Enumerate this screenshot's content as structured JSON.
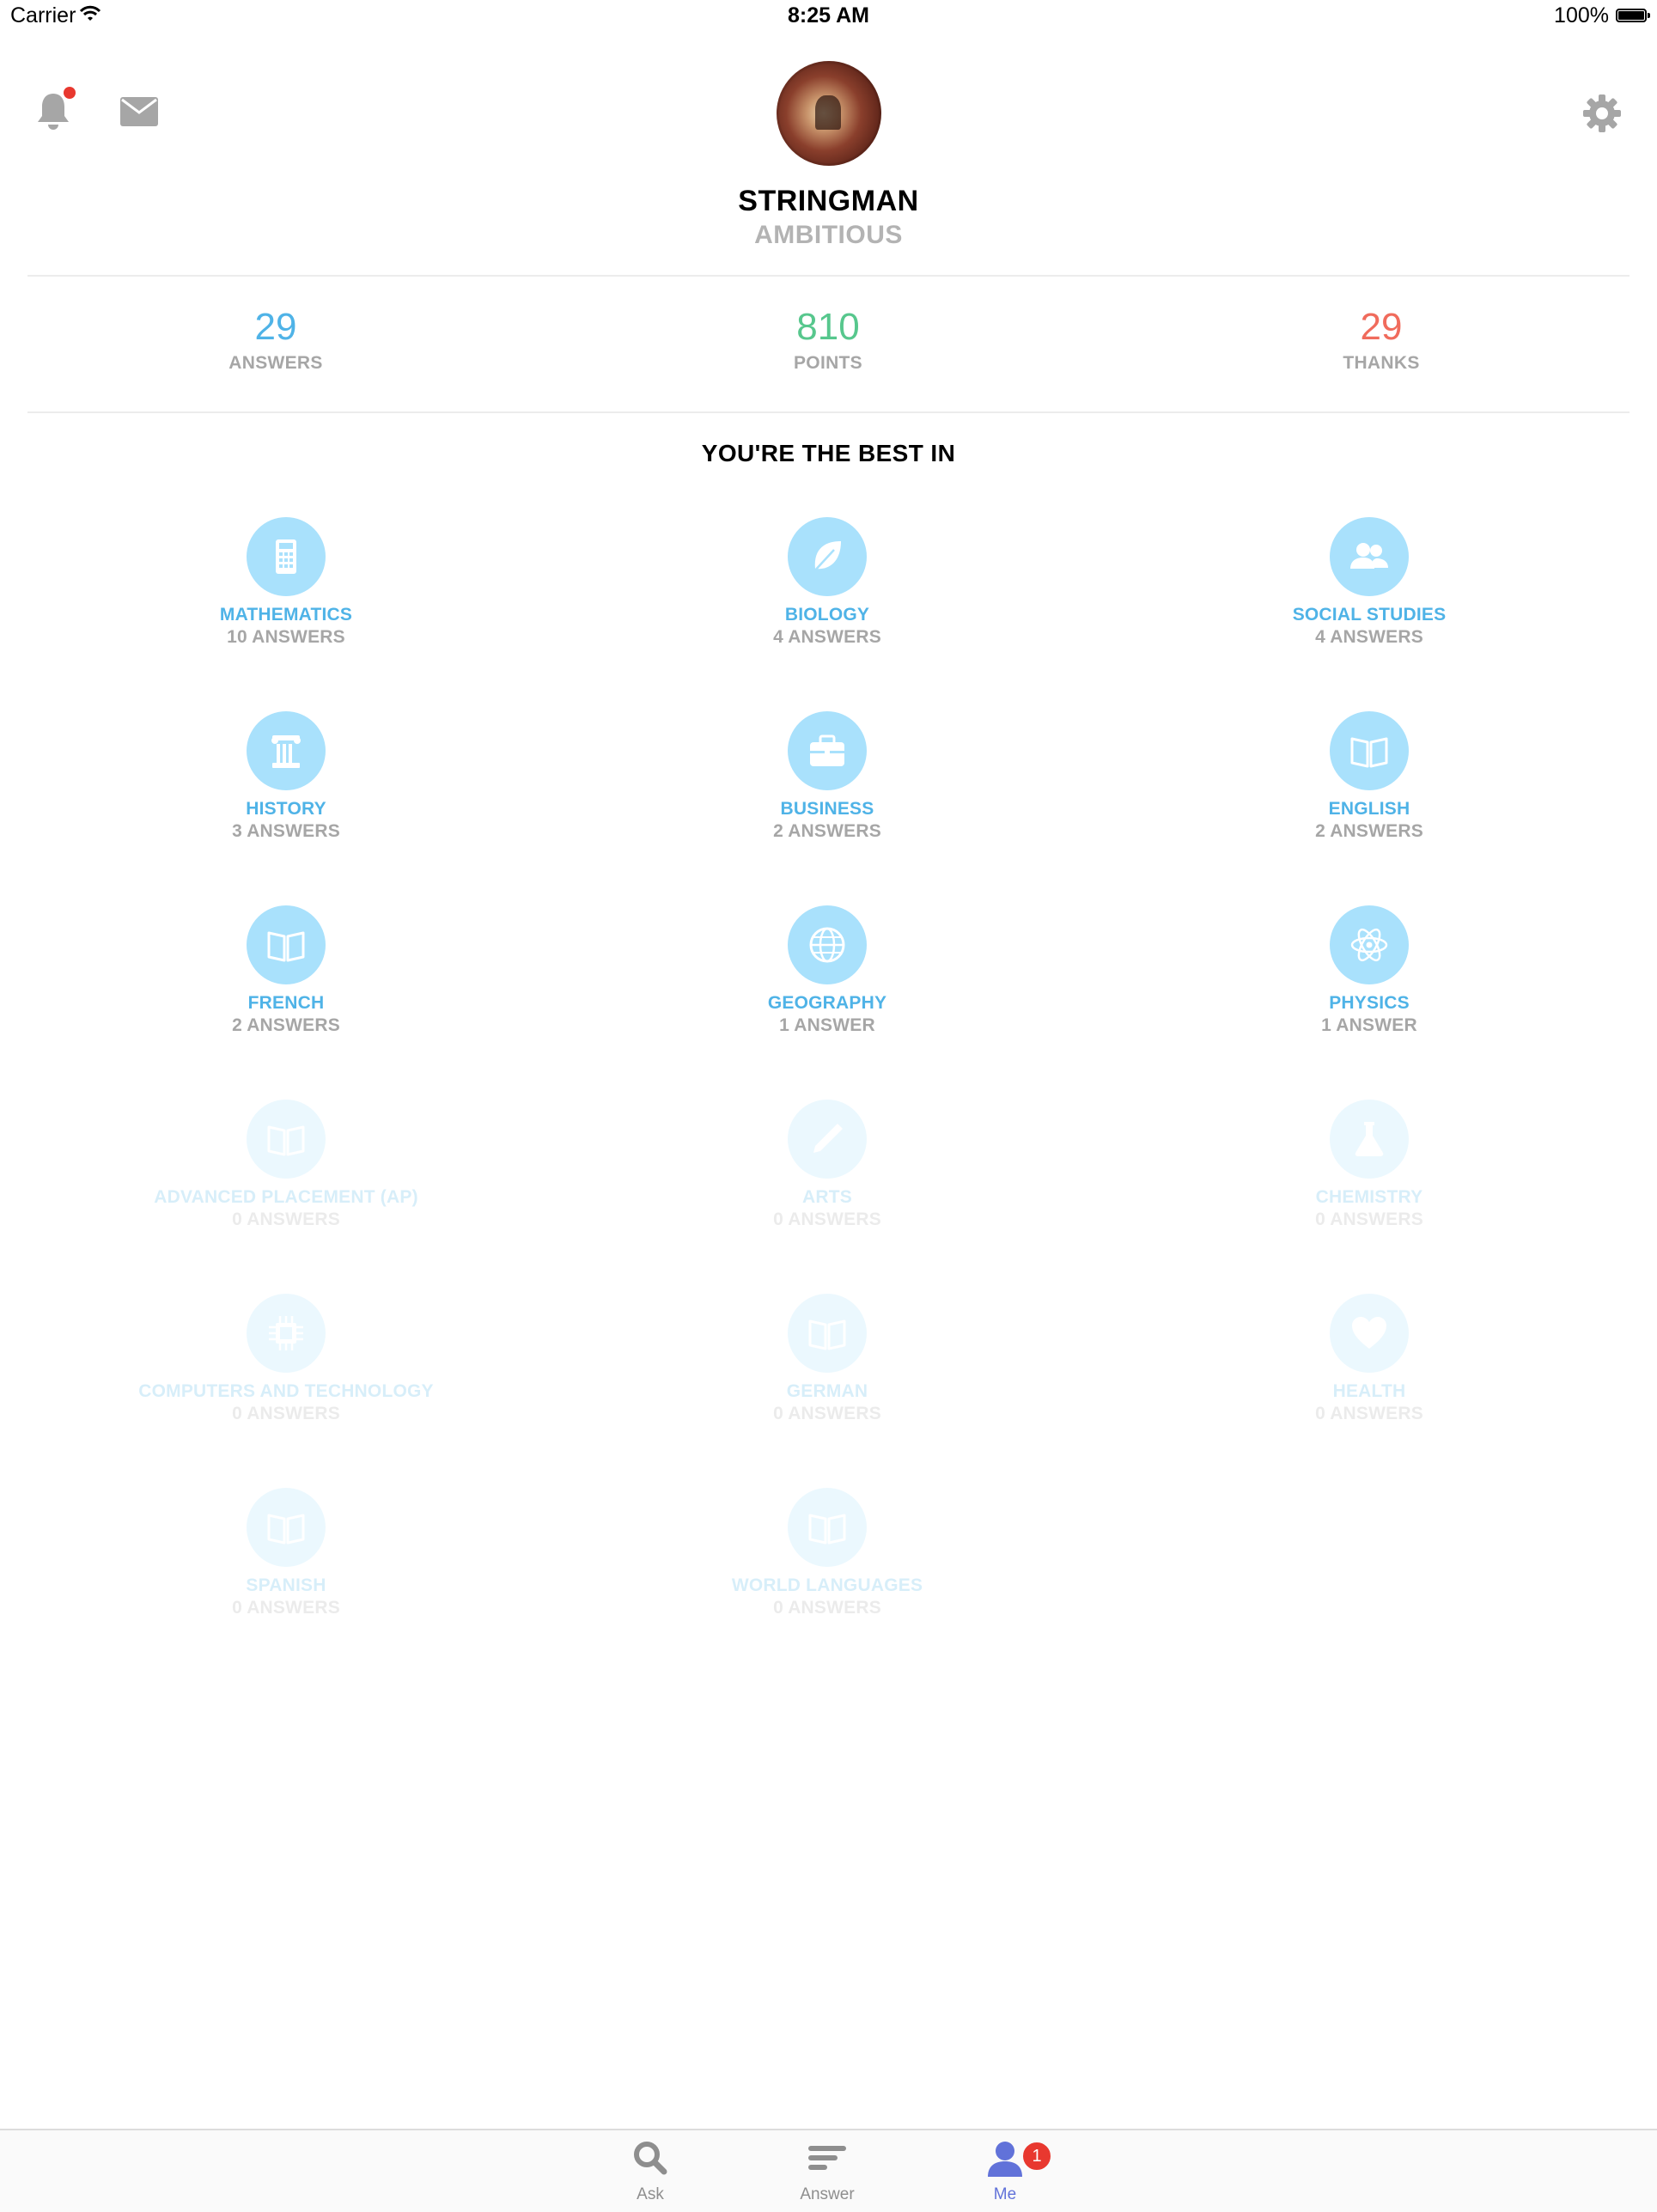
{
  "status_bar": {
    "carrier": "Carrier",
    "time": "8:25 AM",
    "battery": "100%"
  },
  "profile": {
    "username": "STRINGMAN",
    "rank": "AMBITIOUS"
  },
  "stats": {
    "answers": {
      "value": "29",
      "label": "ANSWERS"
    },
    "points": {
      "value": "810",
      "label": "POINTS"
    },
    "thanks": {
      "value": "29",
      "label": "THANKS"
    }
  },
  "best_in": {
    "title": "YOU'RE THE BEST IN",
    "subjects": [
      {
        "name": "MATHEMATICS",
        "count": "10 ANSWERS",
        "icon": "calculator-icon"
      },
      {
        "name": "BIOLOGY",
        "count": "4 ANSWERS",
        "icon": "leaf-icon"
      },
      {
        "name": "SOCIAL STUDIES",
        "count": "4 ANSWERS",
        "icon": "people-icon"
      },
      {
        "name": "HISTORY",
        "count": "3 ANSWERS",
        "icon": "column-icon"
      },
      {
        "name": "BUSINESS",
        "count": "2 ANSWERS",
        "icon": "briefcase-icon"
      },
      {
        "name": "ENGLISH",
        "count": "2 ANSWERS",
        "icon": "book-icon"
      },
      {
        "name": "FRENCH",
        "count": "2 ANSWERS",
        "icon": "book-icon"
      },
      {
        "name": "GEOGRAPHY",
        "count": "1 ANSWER",
        "icon": "globe-icon"
      },
      {
        "name": "PHYSICS",
        "count": "1 ANSWER",
        "icon": "atom-icon"
      },
      {
        "name": "ADVANCED PLACEMENT (AP)",
        "count": "0 ANSWERS",
        "icon": "book-icon"
      },
      {
        "name": "ARTS",
        "count": "0 ANSWERS",
        "icon": "pencil-icon"
      },
      {
        "name": "CHEMISTRY",
        "count": "0 ANSWERS",
        "icon": "flask-icon"
      },
      {
        "name": "COMPUTERS AND TECHNOLOGY",
        "count": "0 ANSWERS",
        "icon": "chip-icon"
      },
      {
        "name": "GERMAN",
        "count": "0 ANSWERS",
        "icon": "book-icon"
      },
      {
        "name": "HEALTH",
        "count": "0 ANSWERS",
        "icon": "heart-icon"
      },
      {
        "name": "SPANISH",
        "count": "0 ANSWERS",
        "icon": "book-icon"
      },
      {
        "name": "WORLD LANGUAGES",
        "count": "0 ANSWERS",
        "icon": "book-icon"
      }
    ]
  },
  "tabbar": {
    "tabs": [
      {
        "label": "Ask",
        "icon": "search-icon"
      },
      {
        "label": "Answer",
        "icon": "lines-icon"
      },
      {
        "label": "Me",
        "icon": "user-icon",
        "badge": "1"
      }
    ]
  },
  "colors": {
    "accent_blue": "#4fb3e7",
    "points_green": "#57c78d",
    "thanks_red": "#f06b5c",
    "tab_active": "#6172d9"
  }
}
